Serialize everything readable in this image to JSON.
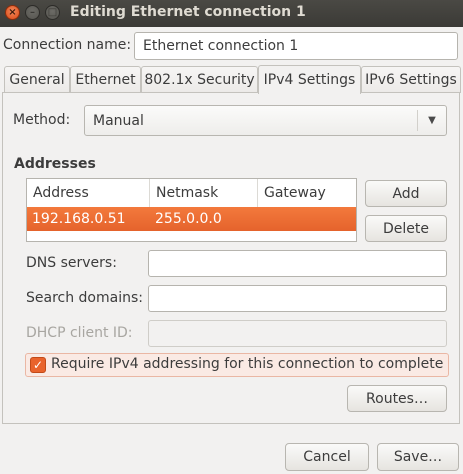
{
  "window": {
    "title": "Editing Ethernet connection 1",
    "close_glyph": "×",
    "minimize_glyph": "–",
    "maximize_glyph": "□"
  },
  "connection": {
    "name_label": "Connection name:",
    "name_value": "Ethernet connection 1"
  },
  "tabs": [
    {
      "label": "General"
    },
    {
      "label": "Ethernet"
    },
    {
      "label": "802.1x Security"
    },
    {
      "label": "IPv4 Settings"
    },
    {
      "label": "IPv6 Settings"
    }
  ],
  "active_tab": "IPv4 Settings",
  "ipv4": {
    "method_label": "Method:",
    "method_value": "Manual",
    "addresses_heading": "Addresses",
    "columns": [
      "Address",
      "Netmask",
      "Gateway"
    ],
    "rows": [
      {
        "address": "192.168.0.51",
        "netmask": "255.0.0.0",
        "gateway": ""
      }
    ],
    "add_label": "Add",
    "delete_label": "Delete",
    "dns_label": "DNS servers:",
    "dns_value": "",
    "search_label": "Search domains:",
    "search_value": "",
    "dhcp_label": "DHCP client ID:",
    "dhcp_value": "",
    "require_label": "Require IPv4 addressing for this connection to complete",
    "require_checked": true,
    "routes_label": "Routes…"
  },
  "footer": {
    "cancel_label": "Cancel",
    "save_label": "Save…"
  },
  "icons": {
    "combo_arrow": "▼",
    "check": "✓"
  },
  "colors": {
    "accent": "#e9632c",
    "titlebar": "#3c3b37"
  }
}
